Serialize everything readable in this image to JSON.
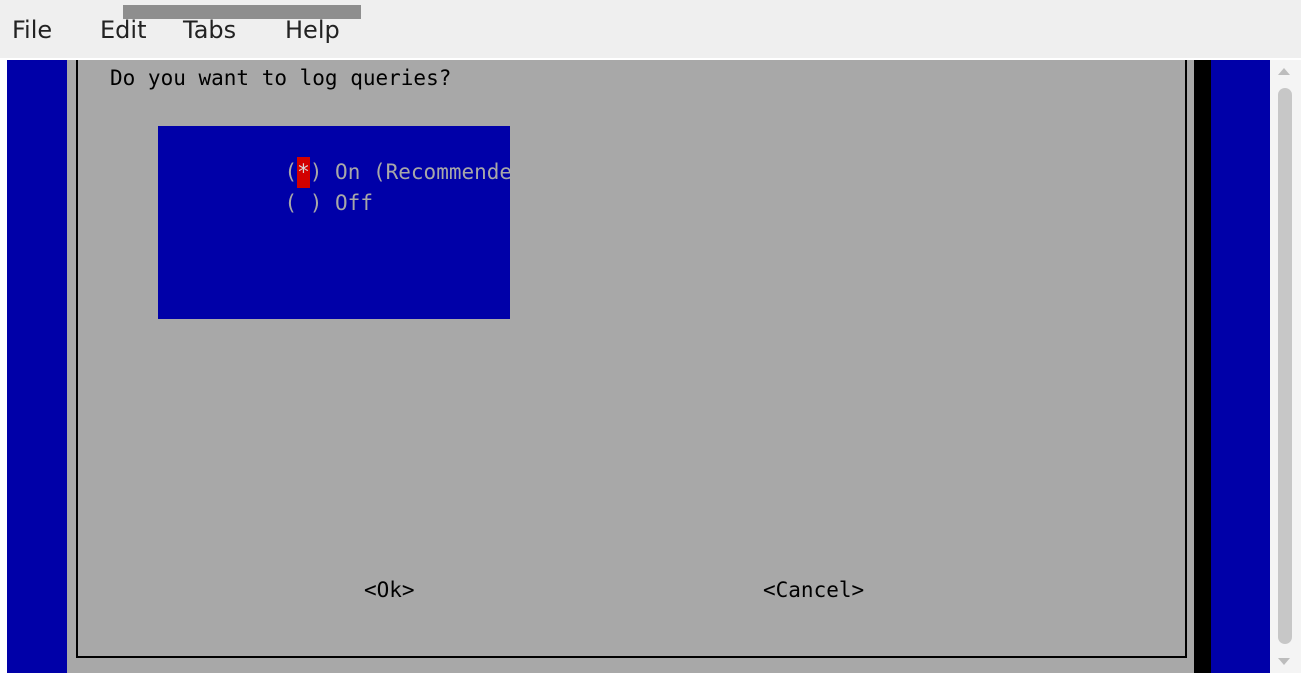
{
  "menu": {
    "file": "File",
    "edit": "Edit",
    "tabs": "Tabs",
    "help": "Help"
  },
  "dialog": {
    "question": "Do you want to log queries?",
    "options": [
      {
        "mark": "(*)",
        "label": "On (Recommended)",
        "selected": true
      },
      {
        "mark": "( )",
        "label": "Off",
        "selected": false
      }
    ],
    "ok": "<Ok>",
    "cancel": "<Cancel>"
  },
  "colors": {
    "terminal_bg": "#0000a8",
    "dialog_bg": "#a8a8a8",
    "selection_red": "#d20000"
  }
}
